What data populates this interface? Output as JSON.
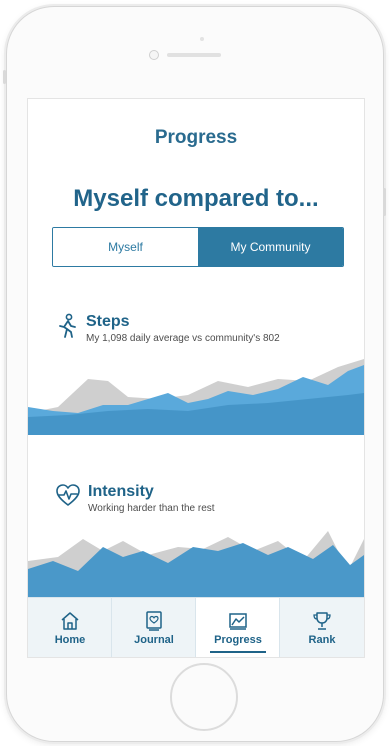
{
  "screen": {
    "title": "Progress",
    "headline": "Myself compared to..."
  },
  "toggle": {
    "options": [
      {
        "label": "Myself",
        "selected": false
      },
      {
        "label": "My Community",
        "selected": true
      }
    ]
  },
  "metrics": [
    {
      "title": "Steps",
      "subtitle": "My 1,098 daily average vs community's 802",
      "icon": "walking-person-icon"
    },
    {
      "title": "Intensity",
      "subtitle": "Working harder than the rest",
      "icon": "heart-rate-icon"
    }
  ],
  "tabs": [
    {
      "label": "Home",
      "icon": "home-icon",
      "active": false
    },
    {
      "label": "Journal",
      "icon": "journal-icon",
      "active": false
    },
    {
      "label": "Progress",
      "icon": "chart-icon",
      "active": true
    },
    {
      "label": "Rank",
      "icon": "trophy-icon",
      "active": false
    }
  ],
  "colors": {
    "primary": "#2d7aa2",
    "title": "#21648a",
    "chart_fill": "#4a98c9",
    "chart_fill_light": "#5aa9db",
    "chart_community": "#c9c9c9"
  }
}
